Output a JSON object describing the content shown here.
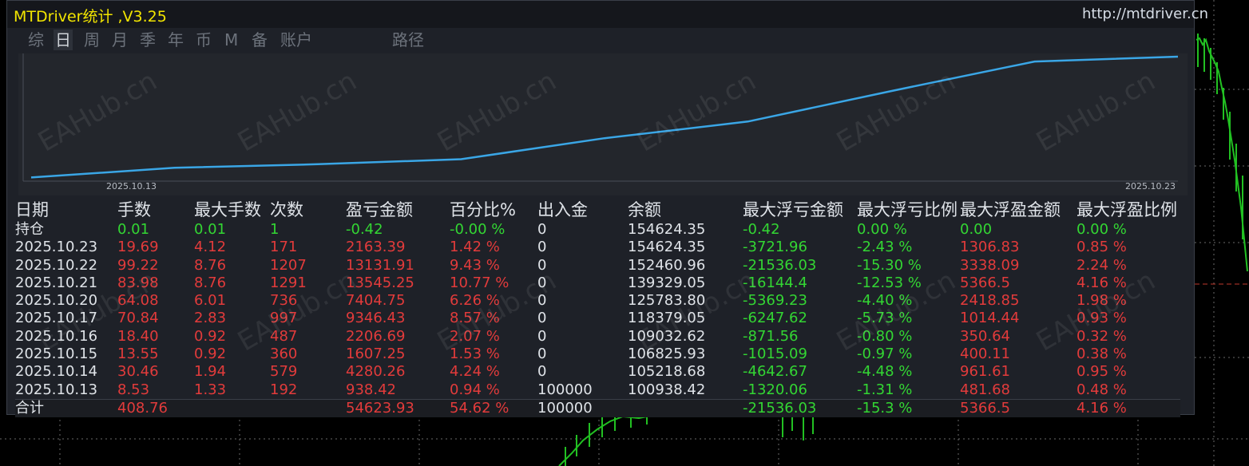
{
  "app": {
    "title": "MTDriver统计  ,V3.25",
    "site": "http://mtdriver.cn",
    "tabs": [
      "综",
      "日",
      "周",
      "月",
      "季",
      "年",
      "币",
      "M",
      "备",
      "账户",
      "路径"
    ],
    "active_tab": "日",
    "watermark": "EAHub.cn"
  },
  "equity": {
    "start_date": "2025.10.13",
    "end_date": "2025.10.23",
    "line_color": "#3aa6e6",
    "balance_points": [
      100938.42,
      105218.68,
      106825.93,
      109032.62,
      118379.05,
      125783.8,
      139329.05,
      152460.96,
      154624.35
    ]
  },
  "table": {
    "headers": [
      "日期",
      "手数",
      "最大手数",
      "次数",
      "盈亏金额",
      "百分比%",
      "出入金",
      "余额",
      "最大浮亏金额",
      "最大浮亏比例",
      "最大浮盈金额",
      "最大浮盈比例"
    ],
    "position_row": [
      "持仓",
      "0.01",
      "0.01",
      "1",
      "-0.42",
      "-0.00 %",
      "0",
      "154624.35",
      "-0.42",
      "0.00 %",
      "0.00",
      "0.00 %"
    ],
    "rows": [
      [
        "2025.10.23",
        "19.69",
        "4.12",
        "171",
        "2163.39",
        "1.42 %",
        "0",
        "154624.35",
        "-3721.96",
        "-2.43 %",
        "1306.83",
        "0.85 %"
      ],
      [
        "2025.10.22",
        "99.22",
        "8.76",
        "1207",
        "13131.91",
        "9.43 %",
        "0",
        "152460.96",
        "-21536.03",
        "-15.30 %",
        "3338.09",
        "2.24 %"
      ],
      [
        "2025.10.21",
        "83.98",
        "8.76",
        "1291",
        "13545.25",
        "10.77 %",
        "0",
        "139329.05",
        "-16144.4",
        "-12.53 %",
        "5366.5",
        "4.16 %"
      ],
      [
        "2025.10.20",
        "64.08",
        "6.01",
        "736",
        "7404.75",
        "6.26 %",
        "0",
        "125783.80",
        "-5369.23",
        "-4.40 %",
        "2418.85",
        "1.98 %"
      ],
      [
        "2025.10.17",
        "70.84",
        "2.83",
        "997",
        "9346.43",
        "8.57 %",
        "0",
        "118379.05",
        "-6247.62",
        "-5.73 %",
        "1014.44",
        "0.93 %"
      ],
      [
        "2025.10.16",
        "18.40",
        "0.92",
        "487",
        "2206.69",
        "2.07 %",
        "0",
        "109032.62",
        "-871.56",
        "-0.80 %",
        "350.64",
        "0.32 %"
      ],
      [
        "2025.10.15",
        "13.55",
        "0.92",
        "360",
        "1607.25",
        "1.53 %",
        "0",
        "106825.93",
        "-1015.09",
        "-0.97 %",
        "400.11",
        "0.38 %"
      ],
      [
        "2025.10.14",
        "30.46",
        "1.94",
        "579",
        "4280.26",
        "4.24 %",
        "0",
        "105218.68",
        "-4642.67",
        "-4.48 %",
        "961.61",
        "0.95 %"
      ],
      [
        "2025.10.13",
        "8.53",
        "1.33",
        "192",
        "938.42",
        "0.94 %",
        "100000",
        "100938.42",
        "-1320.06",
        "-1.31 %",
        "481.68",
        "0.48 %"
      ]
    ],
    "total_row": [
      "合计",
      "408.76",
      "",
      "",
      "54623.93",
      "54.62 %",
      "100000",
      "",
      "-21536.03",
      "-15.3 %",
      "5366.5",
      "4.16 %"
    ]
  },
  "colors": {
    "positive": "#e23b3b",
    "negative": "#33d633",
    "title": "#f2e500",
    "background": "#1e2128"
  }
}
